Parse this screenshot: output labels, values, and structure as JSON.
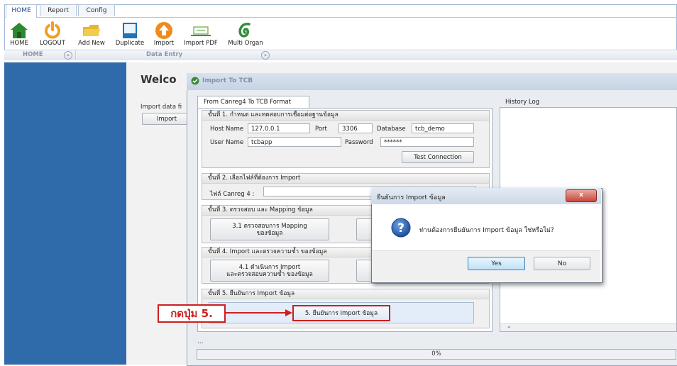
{
  "ribbon": {
    "tabs": [
      {
        "label": "HOME",
        "active": true
      },
      {
        "label": "Report",
        "active": false
      },
      {
        "label": "Config",
        "active": false
      }
    ],
    "tools": [
      {
        "label": "HOME",
        "icon": "home-icon"
      },
      {
        "label": "LOGOUT",
        "icon": "power-icon"
      },
      {
        "label": "Add New",
        "icon": "add-new-icon"
      },
      {
        "label": "Duplicate",
        "icon": "duplicate-icon"
      },
      {
        "label": "Import",
        "icon": "upload-icon"
      },
      {
        "label": "Import PDF",
        "icon": "import-pdf-icon"
      },
      {
        "label": "Multi Organ",
        "icon": "multi-organ-icon"
      }
    ],
    "groups": {
      "home": "HOME",
      "data_entry": "Data Entry"
    }
  },
  "main": {
    "welcome": "Welco",
    "import_label": "Import data fi",
    "import_button": "Import"
  },
  "import_dialog": {
    "title": "Import To TCB",
    "tab": "From Canreg4 To TCB Format",
    "history_label": "History Log",
    "step1": {
      "header": "ขั้นที่ 1. กำหนด และทดสอบการเชื่อมต่อฐานข้อมูล",
      "host_label": "Host Name",
      "host_value": "127.0.0.1",
      "port_label": "Port",
      "port_value": "3306",
      "db_label": "Database",
      "db_value": "tcb_demo",
      "user_label": "User Name",
      "user_value": "tcbapp",
      "password_label": "Password",
      "password_value": "******",
      "test_button": "Test Connection"
    },
    "step2": {
      "header": "ขั้นที่ 2. เลือกไฟล์ที่ต้องการ Import",
      "file_label": "ไฟล์ Canreg 4 :"
    },
    "step3": {
      "header": "ขั้นที่ 3. ตรวจสอบ และ Mapping ข้อมูล",
      "button_line1": "3.1 ตรวจสอบการ Mapping",
      "button_line2": "ของข้อมูล"
    },
    "step4": {
      "header": "ขั้นที่ 4. Import และตรวจความซ้ำ ของข้อมูล",
      "button_line1": "4.1 ดำเนินการ Import",
      "button_line2": "และตรวจสอบความซ้ำ ของข้อมูล"
    },
    "step5": {
      "header": "ขั้นที่ 5. ยืนยันการ Import ข้อมูล",
      "button": "5. ยืนยันการ Import ข้อมูล"
    },
    "status_text": "...",
    "progress": {
      "value": 0,
      "label": "0%"
    }
  },
  "annotation": {
    "text": "กดปุ่ม 5.",
    "color": "#cc1f1f"
  },
  "confirm_dialog": {
    "title": "ยืนยันการ Import ข้อมูล",
    "message": "ท่านต้องการยืนยันการ Import ข้อมูล ใช่หรือไม่?",
    "yes": "Yes",
    "no": "No",
    "close": "x"
  },
  "colors": {
    "left_panel": "#2f6aaa",
    "accent": "#1e4d8f",
    "annotation": "#cc1f1f"
  }
}
